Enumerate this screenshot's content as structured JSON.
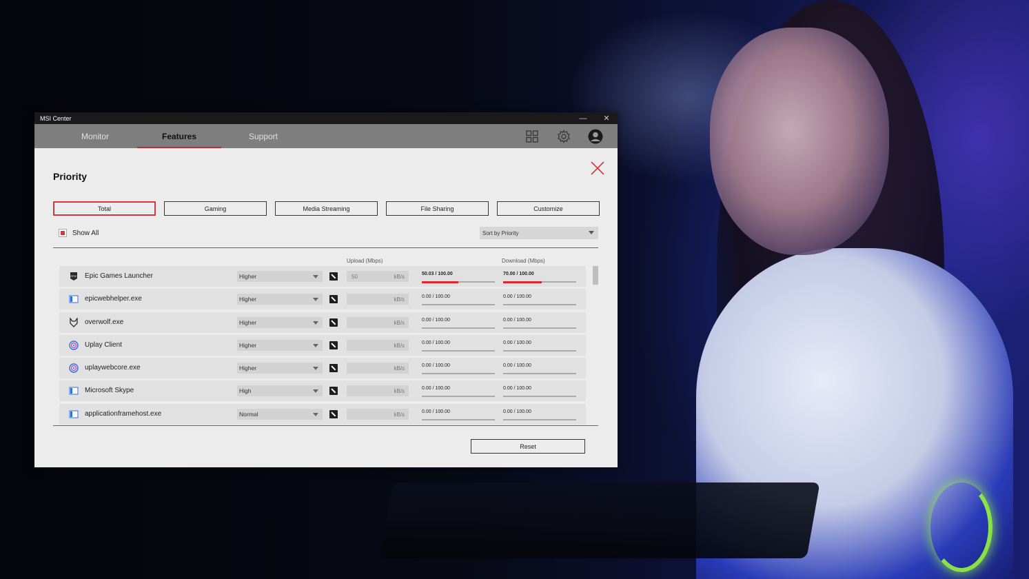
{
  "window": {
    "title": "MSI Center",
    "minimize_glyph": "—",
    "close_glyph": "✕"
  },
  "nav": {
    "tabs": [
      {
        "label": "Monitor",
        "active": false
      },
      {
        "label": "Features",
        "active": true
      },
      {
        "label": "Support",
        "active": false
      }
    ],
    "icons": [
      "grid-icon",
      "gear-icon",
      "avatar-icon"
    ]
  },
  "page": {
    "title": "Priority",
    "close_icon": "close-icon",
    "accent_color": "#d8363f"
  },
  "filters": [
    {
      "label": "Total",
      "active": true
    },
    {
      "label": "Gaming",
      "active": false
    },
    {
      "label": "Media Streaming",
      "active": false
    },
    {
      "label": "File Sharing",
      "active": false
    },
    {
      "label": "Customize",
      "active": false
    }
  ],
  "show_all": {
    "label": "Show All",
    "checked": true
  },
  "sort": {
    "selected": "Sort by Priority"
  },
  "columns": {
    "upload": "Upload (Mbps)",
    "download": "Download (Mbps)"
  },
  "apps": [
    {
      "name": "Epic Games Launcher",
      "icon": "epic-games-icon",
      "priority": "Higher",
      "limit_value": "50",
      "limit_unit": "kB/s",
      "upload": "50.03 / 100.00",
      "upload_fraction": 0.5003,
      "download": "70.00 / 100.00",
      "download_fraction": 0.53
    },
    {
      "name": "epicwebhelper.exe",
      "icon": "window-app-icon",
      "priority": "Higher",
      "limit_value": "",
      "limit_unit": "kB/s",
      "upload": "0.00 / 100.00",
      "upload_fraction": 0,
      "download": "0.00 / 100.00",
      "download_fraction": 0
    },
    {
      "name": "overwolf.exe",
      "icon": "overwolf-icon",
      "priority": "Higher",
      "limit_value": "",
      "limit_unit": "kB/s",
      "upload": "0.00 / 100.00",
      "upload_fraction": 0,
      "download": "0.00 / 100.00",
      "download_fraction": 0
    },
    {
      "name": "Uplay Client",
      "icon": "uplay-icon",
      "priority": "Higher",
      "limit_value": "",
      "limit_unit": "kB/s",
      "upload": "0.00 / 100.00",
      "upload_fraction": 0,
      "download": "0.00 / 100.00",
      "download_fraction": 0
    },
    {
      "name": "uplaywebcore.exe",
      "icon": "uplay-icon",
      "priority": "Higher",
      "limit_value": "",
      "limit_unit": "kB/s",
      "upload": "0.00 / 100.00",
      "upload_fraction": 0,
      "download": "0.00 / 100.00",
      "download_fraction": 0
    },
    {
      "name": "Microsoft Skype",
      "icon": "window-app-icon",
      "priority": "High",
      "limit_value": "",
      "limit_unit": "kB/s",
      "upload": "0.00 / 100.00",
      "upload_fraction": 0,
      "download": "0.00 / 100.00",
      "download_fraction": 0
    },
    {
      "name": "applicationframehost.exe",
      "icon": "window-app-icon",
      "priority": "Normal",
      "limit_value": "",
      "limit_unit": "kB/s",
      "upload": "0.00 / 100.00",
      "upload_fraction": 0,
      "download": "0.00 / 100.00",
      "download_fraction": 0
    }
  ],
  "reset_label": "Reset"
}
